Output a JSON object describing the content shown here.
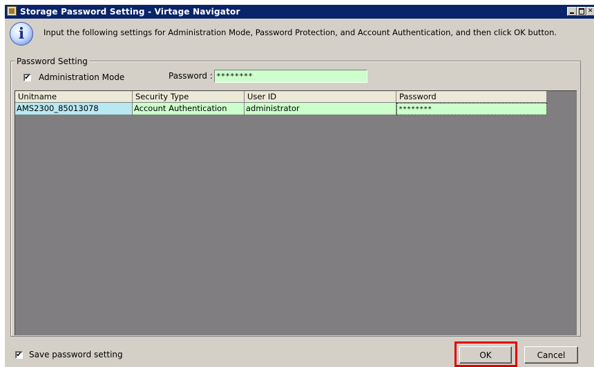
{
  "window": {
    "title": "Storage Password Setting - Virtage Navigator"
  },
  "instruction": "Input the following settings for Administration Mode, Password Protection, and Account Authentication, and then click OK button.",
  "password_setting": {
    "legend": "Password Setting",
    "admin_mode_label": "Administration Mode",
    "admin_mode_checked": true,
    "password_label": "Password :",
    "password_value": "********"
  },
  "table": {
    "columns": [
      "Unitname",
      "Security Type",
      "User ID",
      "Password"
    ],
    "rows": [
      [
        "AMS2300_85013078",
        "Account Authentication",
        "administrator",
        "********"
      ]
    ]
  },
  "footer": {
    "save_label": "Save password setting",
    "save_checked": true,
    "ok_label": "OK",
    "cancel_label": "Cancel"
  },
  "colors": {
    "titlebar": "#0a246a",
    "input_green": "#ccffcc",
    "unit_cell": "#b8e8f0",
    "grid_bg": "#807e80",
    "highlight": "#e00000"
  },
  "icons": {
    "info": "information-icon",
    "app": "app-cube-icon"
  }
}
